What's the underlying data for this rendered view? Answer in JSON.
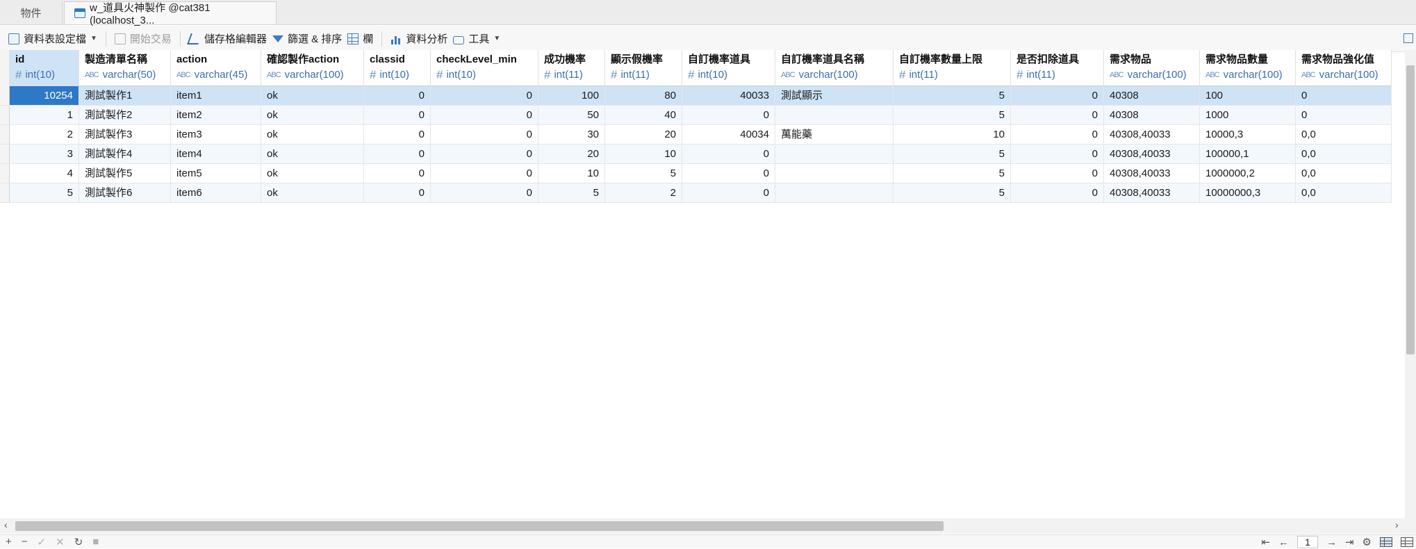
{
  "tabs": [
    {
      "label": "物件"
    },
    {
      "label": "w_道具火神製作 @cat381 (localhost_3..."
    }
  ],
  "toolbar": {
    "table_design": "資料表設定檔",
    "begin_transaction": "開始交易",
    "cell_editor": "儲存格編輯器",
    "filter_sort": "篩選 & 排序",
    "columns": "欄",
    "data_analysis": "資料分析",
    "tools": "工具"
  },
  "columns": [
    {
      "name": "id",
      "type": "int(10)",
      "kind": "num"
    },
    {
      "name": "製造清單名稱",
      "type": "varchar(50)",
      "kind": "str"
    },
    {
      "name": "action",
      "type": "varchar(45)",
      "kind": "str"
    },
    {
      "name": "確認製作action",
      "type": "varchar(100)",
      "kind": "str"
    },
    {
      "name": "classid",
      "type": "int(10)",
      "kind": "num"
    },
    {
      "name": "checkLevel_min",
      "type": "int(10)",
      "kind": "num"
    },
    {
      "name": "成功機率",
      "type": "int(11)",
      "kind": "num"
    },
    {
      "name": "顯示假機率",
      "type": "int(11)",
      "kind": "num"
    },
    {
      "name": "自訂機率道具",
      "type": "int(10)",
      "kind": "num"
    },
    {
      "name": "自訂機率道具名稱",
      "type": "varchar(100)",
      "kind": "str"
    },
    {
      "name": "自訂機率數量上限",
      "type": "int(11)",
      "kind": "num"
    },
    {
      "name": "是否扣除道具",
      "type": "int(11)",
      "kind": "num"
    },
    {
      "name": "需求物品",
      "type": "varchar(100)",
      "kind": "str"
    },
    {
      "name": "需求物品數量",
      "type": "varchar(100)",
      "kind": "str"
    },
    {
      "name": "需求物品強化值",
      "type": "varchar(100)",
      "kind": "str"
    }
  ],
  "rows": [
    [
      "10254",
      "測試製作1",
      "item1",
      "ok",
      "0",
      "0",
      "100",
      "80",
      "40033",
      "測試顯示",
      "5",
      "0",
      "40308",
      "100",
      "0"
    ],
    [
      "1",
      "測試製作2",
      "item2",
      "ok",
      "0",
      "0",
      "50",
      "40",
      "0",
      "",
      "5",
      "0",
      "40308",
      "1000",
      "0"
    ],
    [
      "2",
      "測試製作3",
      "item3",
      "ok",
      "0",
      "0",
      "30",
      "20",
      "40034",
      "萬能藥",
      "10",
      "0",
      "40308,40033",
      "10000,3",
      "0,0"
    ],
    [
      "3",
      "測試製作4",
      "item4",
      "ok",
      "0",
      "0",
      "20",
      "10",
      "0",
      "",
      "5",
      "0",
      "40308,40033",
      "100000,1",
      "0,0"
    ],
    [
      "4",
      "測試製作5",
      "item5",
      "ok",
      "0",
      "0",
      "10",
      "5",
      "0",
      "",
      "5",
      "0",
      "40308,40033",
      "1000000,2",
      "0,0"
    ],
    [
      "5",
      "測試製作6",
      "item6",
      "ok",
      "0",
      "0",
      "5",
      "2",
      "0",
      "",
      "5",
      "0",
      "40308,40033",
      "10000000,3",
      "0,0"
    ]
  ],
  "status": {
    "page": "1"
  }
}
